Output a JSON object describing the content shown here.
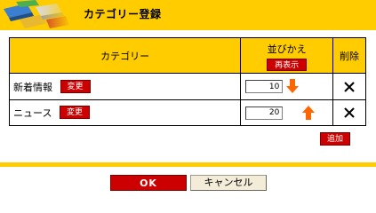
{
  "header": {
    "title": "カテゴリー登録",
    "logo_icon": "stacked-books-logo"
  },
  "table": {
    "col_category": "カテゴリー",
    "col_sort": "並びかえ",
    "col_delete": "削除",
    "redisplay_label": "再表示",
    "rows": [
      {
        "name": "新着情報",
        "change_label": "変更",
        "order": "10",
        "arrow": "down-arrow-icon"
      },
      {
        "name": "ニュース",
        "change_label": "変更",
        "order": "20",
        "arrow": "up-arrow-icon"
      }
    ]
  },
  "add_label": "追加",
  "footer": {
    "ok_label": "OK",
    "cancel_label": "キャンセル"
  },
  "colors": {
    "header_yellow": "#ffcc00",
    "button_red": "#cc0000",
    "arrow_orange": "#ff6600"
  }
}
